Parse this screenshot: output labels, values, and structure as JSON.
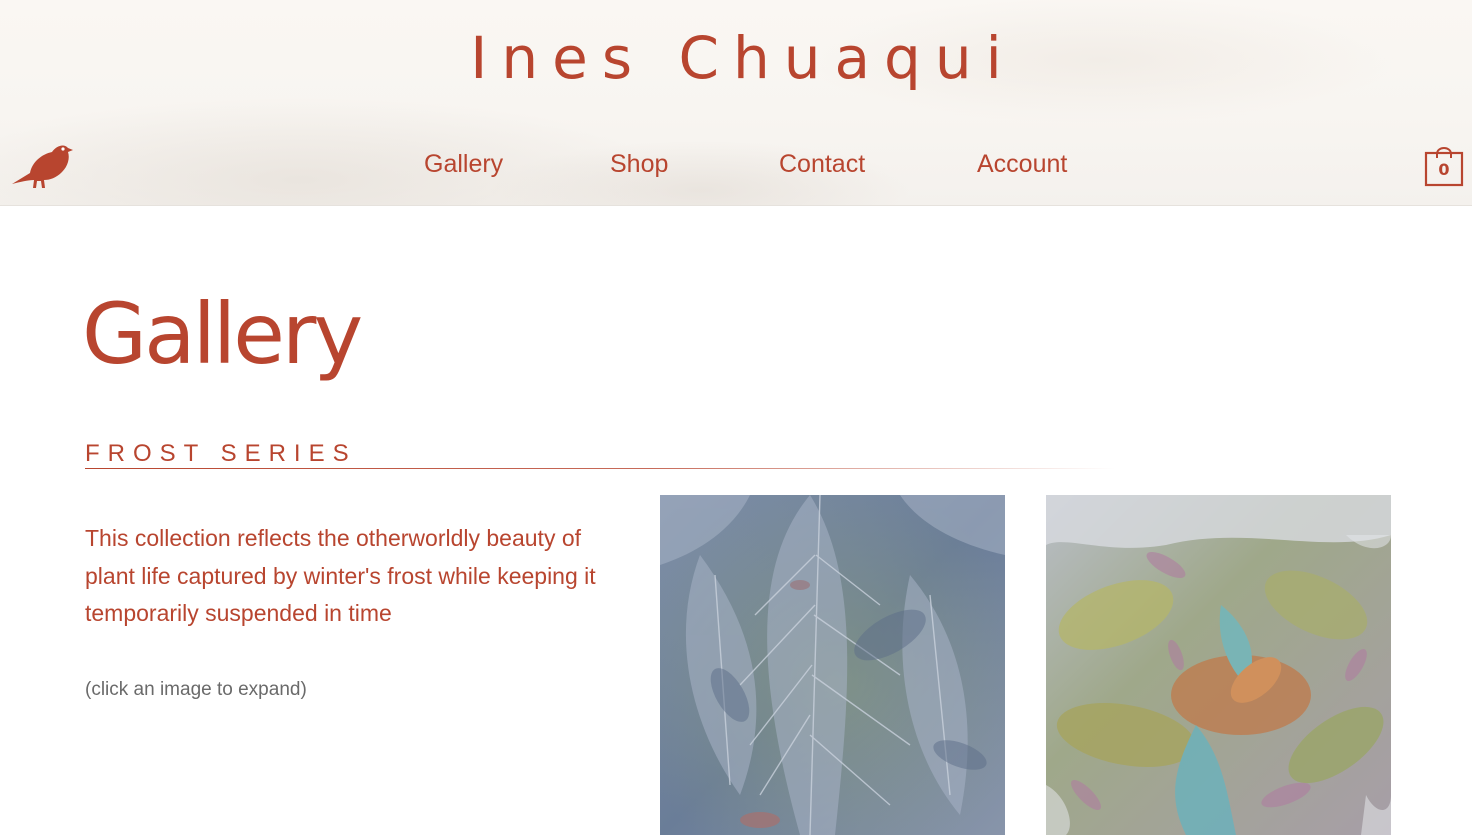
{
  "header": {
    "site_title": "Ines Chuaqui",
    "nav": [
      {
        "label": "Gallery"
      },
      {
        "label": "Shop"
      },
      {
        "label": "Contact"
      },
      {
        "label": "Account"
      }
    ],
    "cart_count": "0",
    "logo_icon": "bird-icon",
    "cart_icon": "shopping-bag-icon"
  },
  "main": {
    "page_title": "Gallery",
    "series_title": "FROST SERIES",
    "description": "This collection reflects the otherworldly beauty of plant life captured by winter's frost while keeping it temporarily suspended in time",
    "hint": "(click an image to expand)",
    "artworks": [
      {
        "palette": "frosted-blue-leaves"
      },
      {
        "palette": "frosted-multicolor-leaves"
      }
    ]
  },
  "colors": {
    "accent": "#b8452f",
    "hint_text": "#6a6a6a"
  }
}
